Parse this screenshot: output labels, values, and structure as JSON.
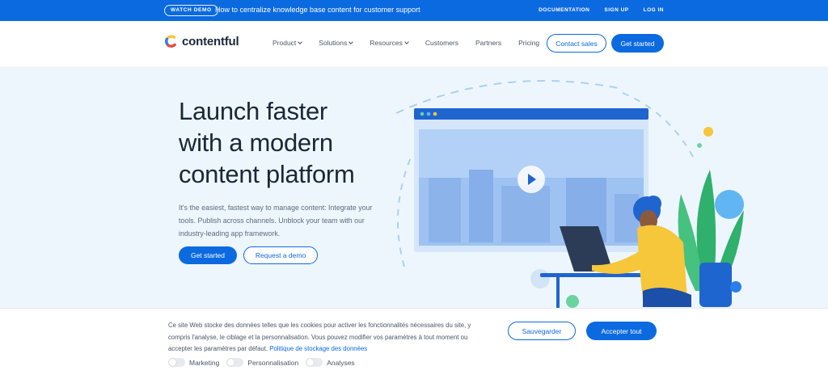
{
  "announcement": {
    "badge": "WATCH DEMO",
    "text": "How to centralize knowledge base content for customer support",
    "links": [
      "DOCUMENTATION",
      "SIGN UP",
      "LOG IN"
    ]
  },
  "nav": {
    "logo_text": "contentful",
    "menu": [
      {
        "label": "Product",
        "dropdown": true
      },
      {
        "label": "Solutions",
        "dropdown": true
      },
      {
        "label": "Resources",
        "dropdown": true
      },
      {
        "label": "Customers",
        "dropdown": false
      },
      {
        "label": "Partners",
        "dropdown": false
      },
      {
        "label": "Pricing",
        "dropdown": false
      }
    ],
    "contact_label": "Contact sales",
    "start_label": "Get started"
  },
  "hero": {
    "title_lines": [
      "Launch faster",
      "with a modern",
      "content platform"
    ],
    "subtitle": "It's the easiest, fastest way to manage content: Integrate your tools. Publish across channels. Unblock your team with our industry-leading app framework.",
    "primary_label": "Get started",
    "secondary_label": "Request a demo"
  },
  "cookie": {
    "text": "Ce site Web stocke des données telles que les cookies pour activer les fonctionnalités nécessaires du site, y compris l'analyse, le ciblage et la personnalisation. Vous pouvez modifier vos paramètres à tout moment ou accepter les paramètres par défaut.",
    "link": "Politique de stockage des données",
    "save_label": "Sauvegarder",
    "accept_label": "Accepter tout",
    "toggles": [
      {
        "label": "Marketing",
        "on": false
      },
      {
        "label": "Personnalisation",
        "on": false
      },
      {
        "label": "Analyses",
        "on": false
      }
    ]
  },
  "colors": {
    "brand_blue": "#0b6ae0",
    "hero_bg": "#eef6fd",
    "text_dark": "#1b273a"
  }
}
